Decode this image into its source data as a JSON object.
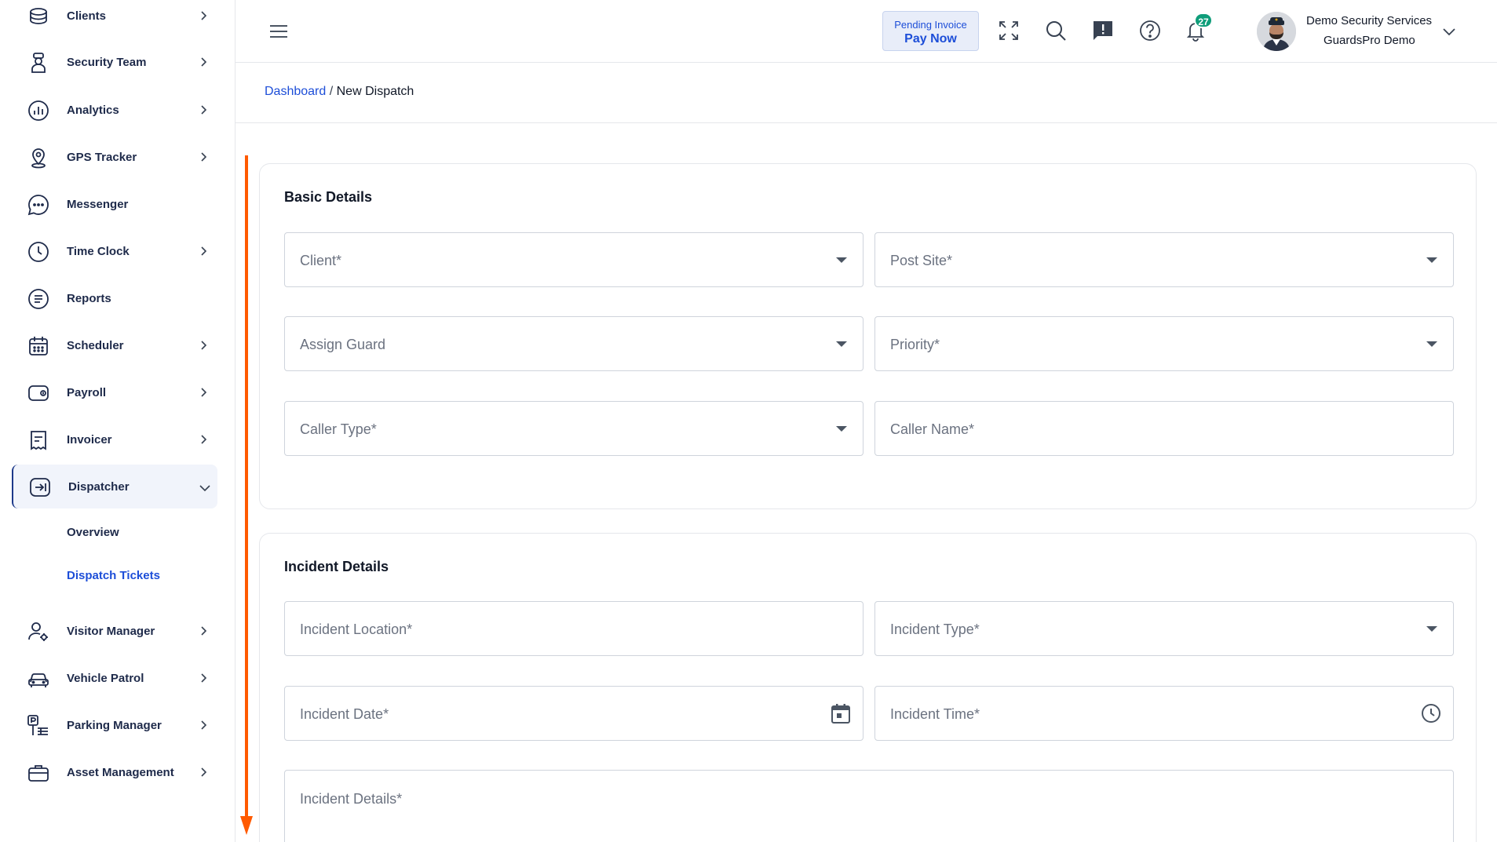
{
  "sidebar": {
    "items": [
      {
        "label": "Clients",
        "icon": "clients-icon",
        "has_chevron": true
      },
      {
        "label": "Security Team",
        "icon": "security-team-icon",
        "has_chevron": true
      },
      {
        "label": "Analytics",
        "icon": "analytics-icon",
        "has_chevron": true
      },
      {
        "label": "GPS Tracker",
        "icon": "gps-pin-icon",
        "has_chevron": true
      },
      {
        "label": "Messenger",
        "icon": "chat-bubble-icon",
        "has_chevron": false
      },
      {
        "label": "Time Clock",
        "icon": "clock-icon",
        "has_chevron": true
      },
      {
        "label": "Reports",
        "icon": "report-icon",
        "has_chevron": false
      },
      {
        "label": "Scheduler",
        "icon": "calendar-icon",
        "has_chevron": true
      },
      {
        "label": "Payroll",
        "icon": "wallet-icon",
        "has_chevron": true
      },
      {
        "label": "Invoicer",
        "icon": "invoice-icon",
        "has_chevron": true
      },
      {
        "label": "Dispatcher",
        "icon": "dispatch-icon",
        "has_chevron": true,
        "expanded": true,
        "active": true
      },
      {
        "label": "Visitor Manager",
        "icon": "visitor-icon",
        "has_chevron": true
      },
      {
        "label": "Vehicle Patrol",
        "icon": "car-icon",
        "has_chevron": true
      },
      {
        "label": "Parking Manager",
        "icon": "parking-icon",
        "has_chevron": true
      },
      {
        "label": "Asset Management",
        "icon": "briefcase-icon",
        "has_chevron": true
      }
    ],
    "dispatcher_sub": [
      {
        "label": "Overview",
        "active": false
      },
      {
        "label": "Dispatch Tickets",
        "active": true
      }
    ]
  },
  "header": {
    "invoice_line1": "Pending Invoice",
    "invoice_line2": "Pay Now",
    "notification_count": "27",
    "user_name": "Demo Security Services",
    "user_org": "GuardsPro Demo",
    "icons": [
      "menu-icon",
      "fullscreen-icon",
      "search-icon",
      "feedback-icon",
      "help-icon",
      "bell-icon",
      "chevron-down-icon"
    ]
  },
  "breadcrumb": {
    "root": "Dashboard",
    "separator": " / ",
    "current": "New Dispatch"
  },
  "basic_details": {
    "title": "Basic Details",
    "fields": {
      "client": "Client*",
      "post_site": "Post Site*",
      "assign_guard": "Assign Guard",
      "priority": "Priority*",
      "caller_type": "Caller Type*",
      "caller_name": "Caller Name*"
    }
  },
  "incident_details": {
    "title": "Incident Details",
    "fields": {
      "location": "Incident Location*",
      "type": "Incident Type*",
      "date": "Incident Date*",
      "time": "Incident Time*",
      "details": "Incident Details*"
    }
  },
  "colors": {
    "accent": "#1d4ed8",
    "nav_text": "#1e2a4a",
    "badge": "#0f9d7a",
    "scroll_arrow": "#ff5a00"
  }
}
